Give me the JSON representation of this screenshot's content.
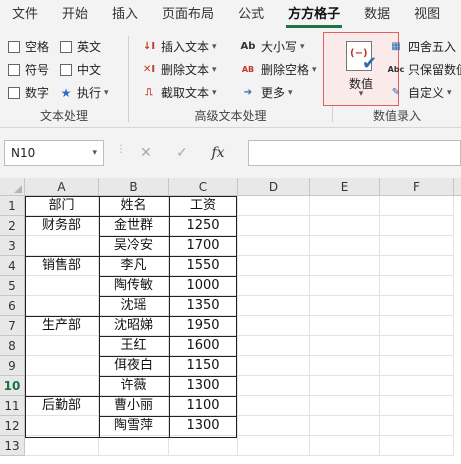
{
  "ribbon_tabs": [
    "文件",
    "开始",
    "插入",
    "页面布局",
    "公式",
    "方方格子",
    "数据",
    "视图"
  ],
  "active_tab": "方方格子",
  "groups": {
    "text_processing": {
      "label": "文本处理",
      "checkboxes": [
        "空格",
        "英文",
        "符号",
        "中文",
        "数字"
      ],
      "run_button": "执行"
    },
    "advanced_text": {
      "label": "高级文本处理",
      "commands": [
        "插入文本",
        "删除文本",
        "截取文本",
        "大小写",
        "删除空格",
        "更多"
      ]
    },
    "numeric_entry": {
      "label": "数值录入",
      "big_button": "数值",
      "commands": [
        "四舍五入",
        "只保留数值",
        "自定义"
      ]
    }
  },
  "formula_bar": {
    "name_box": "N10",
    "fx_label": "fx",
    "formula": ""
  },
  "columns": [
    "A",
    "B",
    "C",
    "D",
    "E",
    "F"
  ],
  "rows": [
    "1",
    "2",
    "3",
    "4",
    "5",
    "6",
    "7",
    "8",
    "9",
    "10",
    "11",
    "12",
    "13"
  ],
  "selected_row": "10",
  "table": {
    "header": [
      "部门",
      "姓名",
      "工资"
    ],
    "body": [
      [
        "财务部",
        "金世群",
        "1250"
      ],
      [
        "",
        "吴冷安",
        "1700"
      ],
      [
        "销售部",
        "李凡",
        "1550"
      ],
      [
        "",
        "陶传敏",
        "1000"
      ],
      [
        "",
        "沈瑶",
        "1350"
      ],
      [
        "生产部",
        "沈昭娣",
        "1950"
      ],
      [
        "",
        "王红",
        "1600"
      ],
      [
        "",
        "佴夜白",
        "1150"
      ],
      [
        "",
        "许薇",
        "1300"
      ],
      [
        "后勤部",
        "曹小丽",
        "1100"
      ],
      [
        "",
        "陶雪萍",
        "1300"
      ]
    ]
  },
  "colors": {
    "accent": "#217346",
    "highlight_border": "#e06060"
  }
}
